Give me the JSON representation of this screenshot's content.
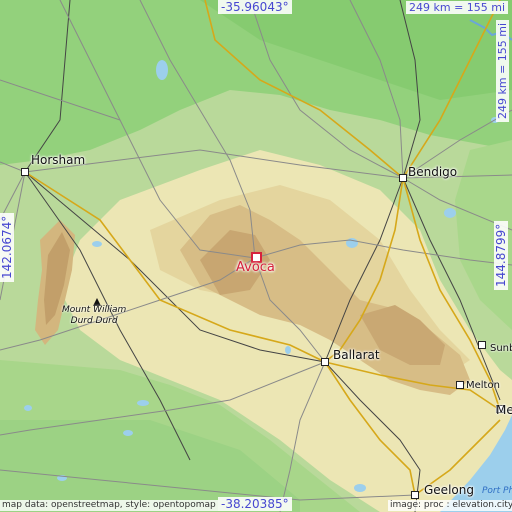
{
  "map": {
    "colors": {
      "lowland": "#b9d99a",
      "green": "#8fd07a",
      "plain": "#eee7b8",
      "hill": "#d9c28a",
      "highland": "#c7a773",
      "water": "#9ccfec",
      "road_major": "#d6a81a",
      "road": "#8a8a8a",
      "rail": "#333333",
      "coord_text": "#4747d1",
      "main_marker": "#d6223c"
    },
    "coords": {
      "top": "-35.96043°",
      "bottom": "-38.20385°",
      "left": "142.0674°",
      "right": "144.8799°"
    },
    "scale": {
      "horizontal": "249 km = 155 mi",
      "vertical": "249 km = 155 mi"
    },
    "main_place": {
      "name": "Avoca",
      "icon": "square-marker-icon"
    },
    "cities": [
      {
        "name": "Horsham"
      },
      {
        "name": "Bendigo"
      },
      {
        "name": "Ballarat"
      },
      {
        "name": "Geelong"
      },
      {
        "name": "Sunb"
      },
      {
        "name": "Melton"
      },
      {
        "name": "Me"
      }
    ],
    "peak": {
      "line1": "Mount William",
      "line2": "Durd Durd",
      "icon": "peak-icon"
    },
    "water_label": "Port Ph",
    "attribution_left": "map data: openstreetmap, style: opentopomap",
    "attribution_right": "image: proc : elevation.city"
  }
}
